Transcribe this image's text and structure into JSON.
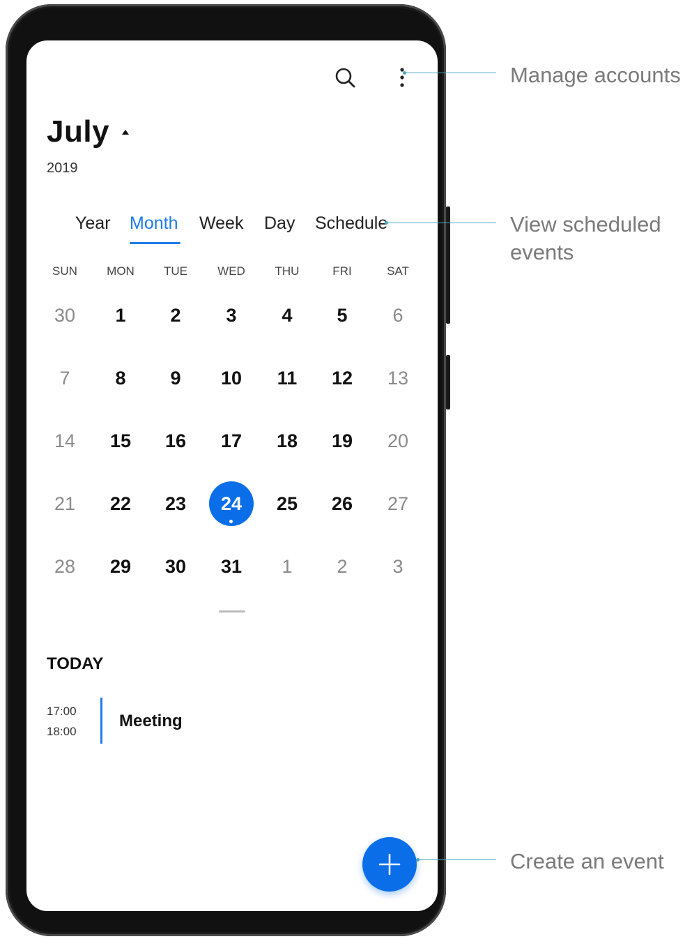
{
  "header": {
    "month": "July",
    "year": "2019"
  },
  "tabs": [
    {
      "label": "Year"
    },
    {
      "label": "Month"
    },
    {
      "label": "Week"
    },
    {
      "label": "Day"
    },
    {
      "label": "Schedule"
    }
  ],
  "weekdays": [
    "SUN",
    "MON",
    "TUE",
    "WED",
    "THU",
    "FRI",
    "SAT"
  ],
  "weeks": [
    [
      "30",
      "1",
      "2",
      "3",
      "4",
      "5",
      "6"
    ],
    [
      "7",
      "8",
      "9",
      "10",
      "11",
      "12",
      "13"
    ],
    [
      "14",
      "15",
      "16",
      "17",
      "18",
      "19",
      "20"
    ],
    [
      "21",
      "22",
      "23",
      "24",
      "25",
      "26",
      "27"
    ],
    [
      "28",
      "29",
      "30",
      "31",
      "1",
      "2",
      "3"
    ]
  ],
  "selected_day": "24",
  "today": {
    "title": "TODAY",
    "event": {
      "start": "17:00",
      "end": "18:00",
      "title": "Meeting"
    }
  },
  "callouts": {
    "manage": "Manage accounts",
    "view_line1": "View scheduled",
    "view_line2": "events",
    "create": "Create an event"
  },
  "colors": {
    "accent": "#1e7be8",
    "selected": "#0a6ee8"
  },
  "icons": {
    "search": "search-icon",
    "more": "more-vertical-icon",
    "add": "plus-icon"
  }
}
